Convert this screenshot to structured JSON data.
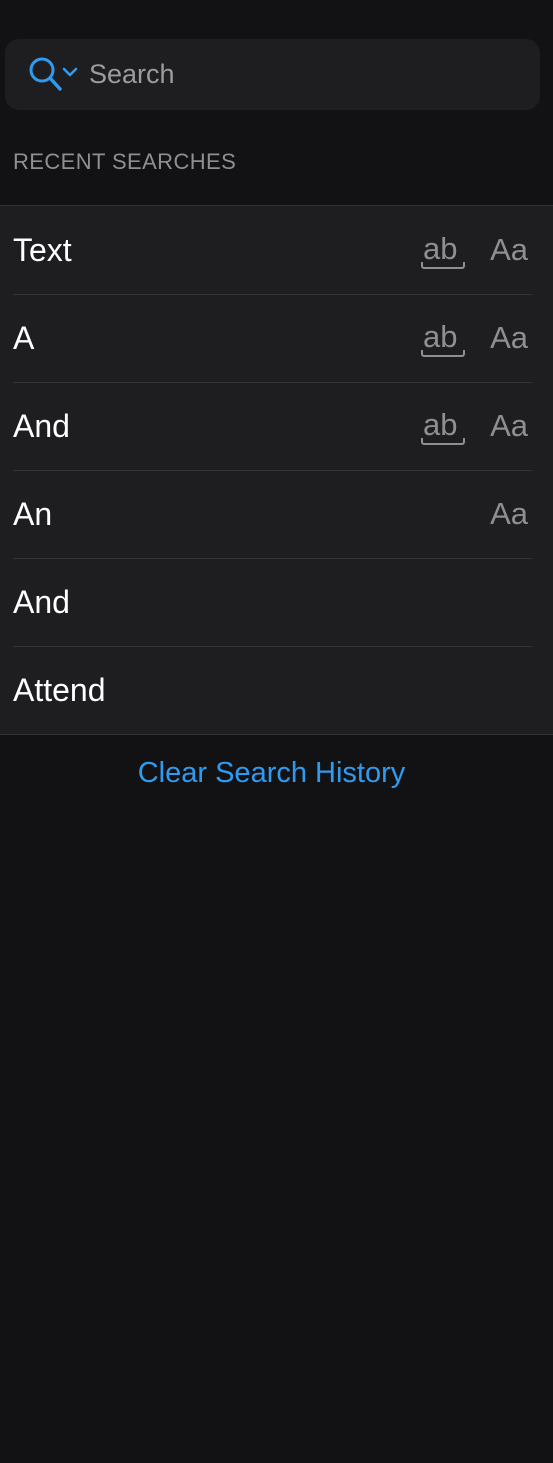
{
  "search": {
    "placeholder": "Search",
    "value": "",
    "icon": "search-options-icon"
  },
  "recent": {
    "header": "RECENT SEARCHES",
    "items": [
      {
        "label": "Text",
        "whole_word": true,
        "match_case": true
      },
      {
        "label": "A",
        "whole_word": true,
        "match_case": true
      },
      {
        "label": "And",
        "whole_word": true,
        "match_case": true
      },
      {
        "label": "An",
        "whole_word": false,
        "match_case": true
      },
      {
        "label": "And",
        "whole_word": false,
        "match_case": false
      },
      {
        "label": "Attend",
        "whole_word": false,
        "match_case": false
      }
    ],
    "whole_word_label": "ab",
    "match_case_label": "Aa"
  },
  "clear_label": "Clear Search History",
  "colors": {
    "background": "#121214",
    "surface": "#1e1e21",
    "accent": "#2f9bf0",
    "secondary_text": "#8e8e93"
  }
}
